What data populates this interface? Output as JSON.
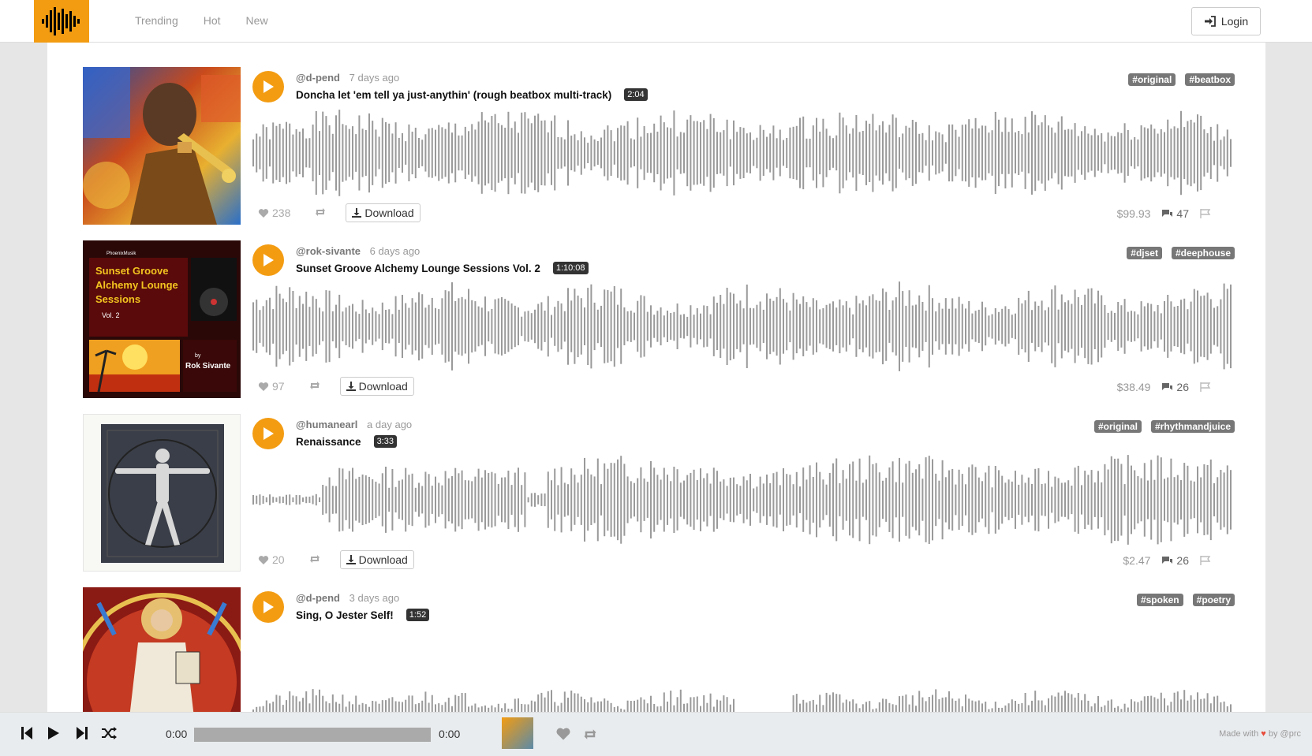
{
  "nav": {
    "items": [
      "Trending",
      "Hot",
      "New"
    ],
    "login_label": "Login"
  },
  "tracks": [
    {
      "user": "@d-pend",
      "ago": "7 days ago",
      "title": "Doncha let 'em tell ya just-anythin' (rough beatbox multi-track)",
      "duration": "2:04",
      "tags": [
        "#original",
        "#beatbox"
      ],
      "likes": "238",
      "download_label": "Download",
      "price": "$99.93",
      "comments": "47",
      "cover": "abstract painting of a trumpet player"
    },
    {
      "user": "@rok-sivante",
      "ago": "6 days ago",
      "title": "Sunset Groove Alchemy Lounge Sessions Vol. 2",
      "duration": "1:10:08",
      "tags": [
        "#djset",
        "#deephouse"
      ],
      "likes": "97",
      "download_label": "Download",
      "price": "$38.49",
      "comments": "26",
      "cover": "album art with sunset and turntable",
      "cover_text": {
        "small": "PhoenixMusik",
        "title": "Sunset Groove Alchemy Lounge Sessions",
        "vol": "Vol. 2",
        "by": "by",
        "artist": "Rok Sivante"
      }
    },
    {
      "user": "@humanearl",
      "ago": "a day ago",
      "title": "Renaissance",
      "duration": "3:33",
      "tags": [
        "#original",
        "#rhythmandjuice"
      ],
      "likes": "20",
      "download_label": "Download",
      "price": "$2.47",
      "comments": "26",
      "cover": "vitruvian man sculpture"
    },
    {
      "user": "@d-pend",
      "ago": "3 days ago",
      "title": "Sing, O Jester Self!",
      "duration": "1:52",
      "tags": [
        "#spoken",
        "#poetry"
      ],
      "cover": "byzantine religious fresco"
    }
  ],
  "player": {
    "time_current": "0:00",
    "time_total": "0:00",
    "footer_made": "Made with",
    "footer_by": "by @prc"
  },
  "colors": {
    "accent": "#f39c12",
    "wave": "#9a9a9a",
    "tag": "#777777"
  }
}
